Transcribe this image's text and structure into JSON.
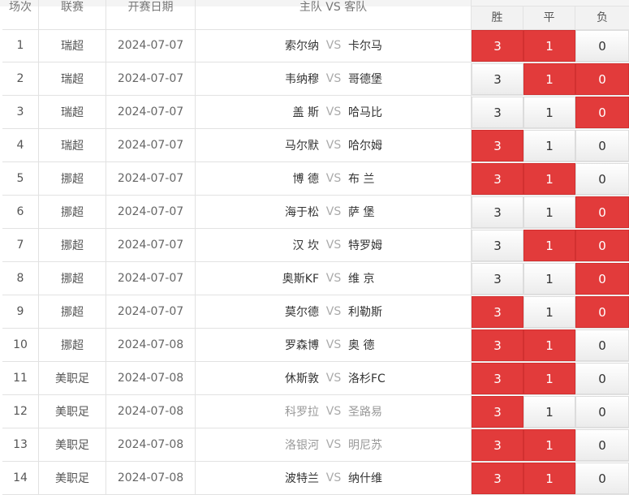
{
  "header": {
    "col_no": "场次",
    "col_league": "联赛",
    "col_date": "开赛日期",
    "col_teams": "主队 VS 客队",
    "col_win": "胜",
    "col_draw": "平",
    "col_lose": "负"
  },
  "vs_label": "VS",
  "matches": [
    {
      "no": "1",
      "league": "瑞超",
      "date": "2024-07-07",
      "home": "索尔纳",
      "away": "卡尔马",
      "muted": false,
      "win": "3",
      "draw": "1",
      "lose": "0",
      "sel": [
        true,
        true,
        false
      ]
    },
    {
      "no": "2",
      "league": "瑞超",
      "date": "2024-07-07",
      "home": "韦纳穆",
      "away": "哥德堡",
      "muted": false,
      "win": "3",
      "draw": "1",
      "lose": "0",
      "sel": [
        false,
        true,
        true
      ]
    },
    {
      "no": "3",
      "league": "瑞超",
      "date": "2024-07-07",
      "home": "盖 斯",
      "away": "哈马比",
      "muted": false,
      "win": "3",
      "draw": "1",
      "lose": "0",
      "sel": [
        false,
        false,
        true
      ]
    },
    {
      "no": "4",
      "league": "瑞超",
      "date": "2024-07-07",
      "home": "马尔默",
      "away": "哈尔姆",
      "muted": false,
      "win": "3",
      "draw": "1",
      "lose": "0",
      "sel": [
        true,
        false,
        false
      ]
    },
    {
      "no": "5",
      "league": "挪超",
      "date": "2024-07-07",
      "home": "博 德",
      "away": "布 兰",
      "muted": false,
      "win": "3",
      "draw": "1",
      "lose": "0",
      "sel": [
        true,
        true,
        false
      ]
    },
    {
      "no": "6",
      "league": "挪超",
      "date": "2024-07-07",
      "home": "海于松",
      "away": "萨 堡",
      "muted": false,
      "win": "3",
      "draw": "1",
      "lose": "0",
      "sel": [
        false,
        false,
        true
      ]
    },
    {
      "no": "7",
      "league": "挪超",
      "date": "2024-07-07",
      "home": "汉 坎",
      "away": "特罗姆",
      "muted": false,
      "win": "3",
      "draw": "1",
      "lose": "0",
      "sel": [
        false,
        true,
        true
      ]
    },
    {
      "no": "8",
      "league": "挪超",
      "date": "2024-07-07",
      "home": "奥斯KF",
      "away": "维 京",
      "muted": false,
      "win": "3",
      "draw": "1",
      "lose": "0",
      "sel": [
        false,
        false,
        true
      ]
    },
    {
      "no": "9",
      "league": "挪超",
      "date": "2024-07-07",
      "home": "莫尔德",
      "away": "利勒斯",
      "muted": false,
      "win": "3",
      "draw": "1",
      "lose": "0",
      "sel": [
        true,
        false,
        true
      ]
    },
    {
      "no": "10",
      "league": "挪超",
      "date": "2024-07-08",
      "home": "罗森博",
      "away": "奥 德",
      "muted": false,
      "win": "3",
      "draw": "1",
      "lose": "0",
      "sel": [
        true,
        true,
        false
      ]
    },
    {
      "no": "11",
      "league": "美职足",
      "date": "2024-07-08",
      "home": "休斯敦",
      "away": "洛杉FC",
      "muted": false,
      "win": "3",
      "draw": "1",
      "lose": "0",
      "sel": [
        true,
        true,
        false
      ]
    },
    {
      "no": "12",
      "league": "美职足",
      "date": "2024-07-08",
      "home": "科罗拉",
      "away": "圣路易",
      "muted": true,
      "win": "3",
      "draw": "1",
      "lose": "0",
      "sel": [
        true,
        false,
        false
      ]
    },
    {
      "no": "13",
      "league": "美职足",
      "date": "2024-07-08",
      "home": "洛银河",
      "away": "明尼苏",
      "muted": true,
      "win": "3",
      "draw": "1",
      "lose": "0",
      "sel": [
        true,
        true,
        false
      ]
    },
    {
      "no": "14",
      "league": "美职足",
      "date": "2024-07-08",
      "home": "波特兰",
      "away": "纳什维",
      "muted": false,
      "win": "3",
      "draw": "1",
      "lose": "0",
      "sel": [
        true,
        true,
        false
      ]
    }
  ],
  "colors": {
    "selected": "#e23b3b",
    "border": "#e2e2e2"
  }
}
